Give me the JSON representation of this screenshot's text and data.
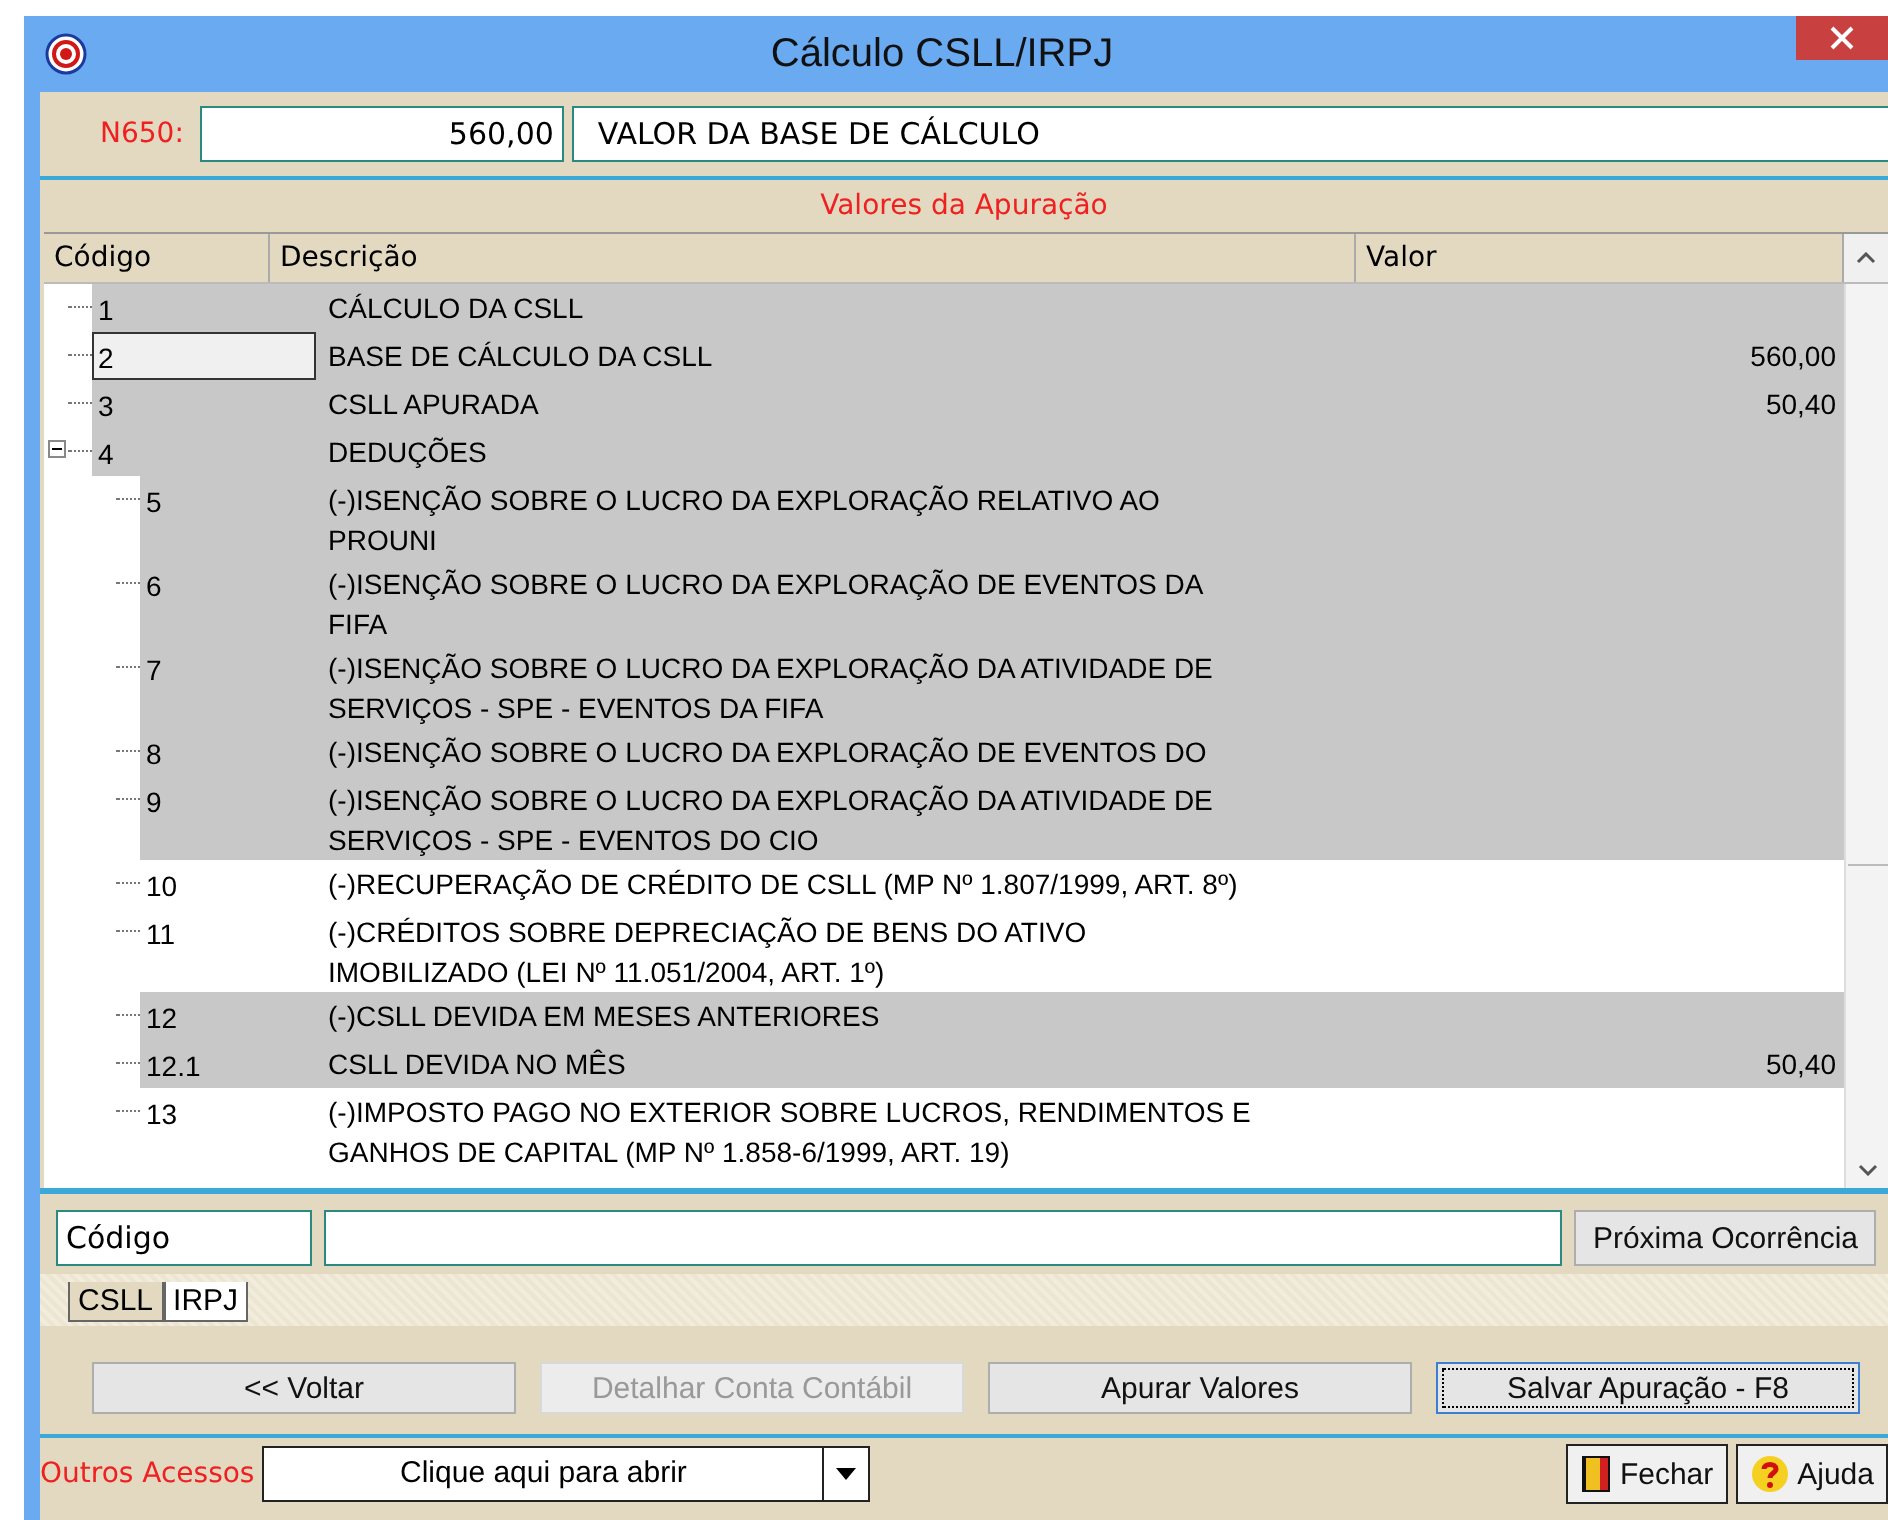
{
  "window": {
    "title": "Cálculo CSLL/IRPJ"
  },
  "n650": {
    "label": "N650:",
    "value": "560,00",
    "description": "VALOR DA BASE DE CÁLCULO"
  },
  "section_title": "Valores da Apuração",
  "table": {
    "columns": [
      "Código",
      "Descrição",
      "Valor"
    ],
    "rows": [
      {
        "code": "1",
        "description": "CÁLCULO DA CSLL",
        "shaded": true,
        "focused": false
      },
      {
        "code": "2",
        "description": "BASE DE CÁLCULO DA CSLL",
        "value": "560,00",
        "shaded": true,
        "focused": true
      },
      {
        "code": "3",
        "description": "CSLL APURADA",
        "value": "50,40",
        "shaded": true,
        "focused": false
      },
      {
        "code": "4",
        "description": "DEDUÇÕES",
        "shaded": true,
        "focused": false,
        "expanded": true,
        "children": [
          {
            "code": "5",
            "description": "(-)ISENÇÃO SOBRE O LUCRO DA EXPLORAÇÃO RELATIVO AO PROUNI",
            "shaded": true,
            "focused": false
          },
          {
            "code": "6",
            "description": "(-)ISENÇÃO SOBRE O LUCRO DA EXPLORAÇÃO DE EVENTOS DA FIFA",
            "shaded": true,
            "focused": false
          },
          {
            "code": "7",
            "description": "(-)ISENÇÃO SOBRE O LUCRO DA EXPLORAÇÃO DA ATIVIDADE DE SERVIÇOS - SPE - EVENTOS DA FIFA",
            "shaded": true,
            "focused": false
          },
          {
            "code": "8",
            "description": "(-)ISENÇÃO SOBRE O LUCRO DA EXPLORAÇÃO DE EVENTOS DO",
            "shaded": true,
            "focused": false
          },
          {
            "code": "9",
            "description": "(-)ISENÇÃO SOBRE O LUCRO DA EXPLORAÇÃO DA ATIVIDADE DE SERVIÇOS - SPE - EVENTOS DO CIO",
            "shaded": true,
            "focused": false
          },
          {
            "code": "10",
            "description": "(-)RECUPERAÇÃO DE CRÉDITO DE CSLL (MP Nº 1.807/1999, ART. 8º)",
            "shaded": false,
            "focused": false
          },
          {
            "code": "11",
            "description": "(-)CRÉDITOS SOBRE DEPRECIAÇÃO DE BENS DO ATIVO IMOBILIZADO (LEI Nº 11.051/2004, ART. 1º)",
            "shaded": false,
            "focused": false
          },
          {
            "code": "12",
            "description": "(-)CSLL DEVIDA EM MESES ANTERIORES",
            "shaded": true,
            "focused": false
          },
          {
            "code": "12.1",
            "description": "CSLL DEVIDA NO MÊS",
            "value": "50,40",
            "shaded": true,
            "focused": false
          },
          {
            "code": "13",
            "description": "(-)IMPOSTO PAGO NO EXTERIOR SOBRE LUCROS, RENDIMENTOS E GANHOS DE CAPITAL (MP Nº 1.858-6/1999, ART. 19)",
            "shaded": false,
            "focused": false
          }
        ]
      }
    ]
  },
  "search": {
    "field_value": "Código",
    "button": "Próxima Ocorrência"
  },
  "tabs": [
    {
      "label": "CSLL",
      "selected": true
    },
    {
      "label": "IRPJ",
      "selected": false
    }
  ],
  "buttons": [
    {
      "label": "<< Voltar",
      "disabled": false,
      "focused": false
    },
    {
      "label": "Detalhar Conta Contábil",
      "disabled": true,
      "focused": false
    },
    {
      "label": "Apurar Valores",
      "disabled": false,
      "focused": false
    },
    {
      "label": "Salvar Apuração - F8",
      "disabled": false,
      "focused": true
    }
  ],
  "footer": {
    "label": "Outros Acessos",
    "dropdown": "Clique aqui para abrir",
    "close_button": "Fechar",
    "help_button": "Ajuda"
  }
}
